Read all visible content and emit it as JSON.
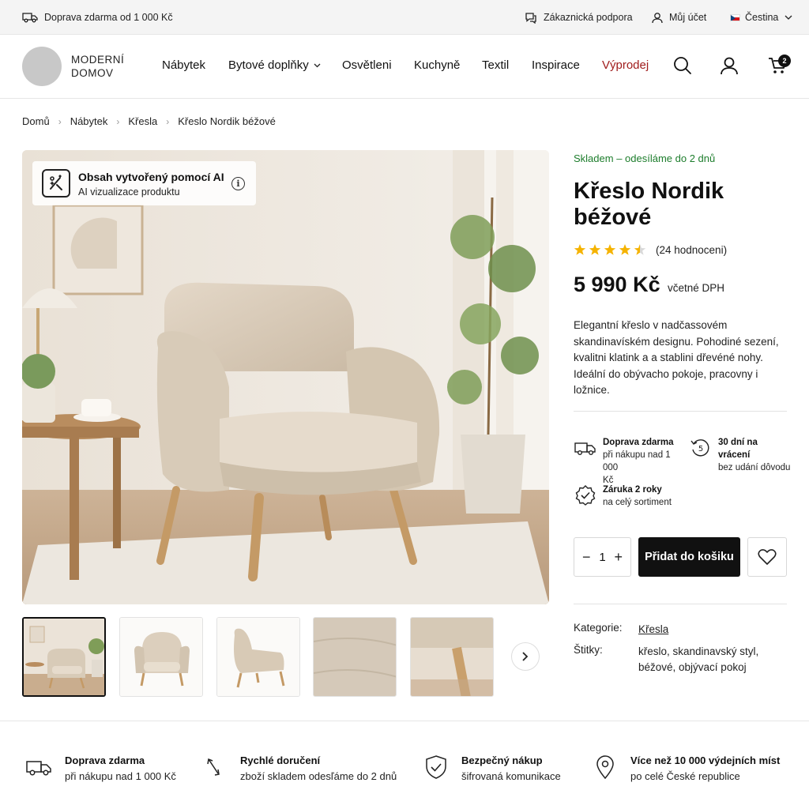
{
  "topbar": {
    "shipping": "Doprava zdarma od 1 000 Kč",
    "support": "Zákaznická podpora",
    "account": "Můj účet",
    "language": "Čestina"
  },
  "header": {
    "logo_line1": "MODERNÍ",
    "logo_line2": "DOMOV",
    "nav": [
      "Nábytek",
      "Bytové doplňky",
      "Osvětleni",
      "Kuchyně",
      "Textil",
      "Inspirace",
      "Výprodej"
    ],
    "cart_count": "2"
  },
  "breadcrumb": [
    "Domů",
    "Nábytek",
    "Křesla",
    "Křeslo Nordik béžové"
  ],
  "ai_badge": {
    "title": "Obsah vytvořený pomocí AI",
    "subtitle": "AI vizualizace produktu"
  },
  "product": {
    "stock": "Skladem – odesíláme do 2 dnů",
    "title_line1": "Křeslo Nordik",
    "title_line2": "béžové",
    "rating_value": 4.5,
    "rating_count": "(24 hodnoceni)",
    "price": "5 990 Kč",
    "price_note": "včetné DPH",
    "description": [
      "Elegantní křeslo v nadčassovém",
      "skandinavíském designu. Pohodiné sezení,",
      "kvalitni klatink a a stablini dřevéné nohy.",
      "Ideální do obývacho pokoje, pracovny i ložnice."
    ],
    "quantity": "1",
    "add_to_cart": "Přidat do košiku",
    "category_label": "Kategorie:",
    "category_value": "Křesla",
    "tags_label": "Štitky:",
    "tags_line1": "křeslo, skandinavský styl,",
    "tags_line2": "béžové, objývací pokoj"
  },
  "benefits": [
    {
      "title": "Doprava zdarma",
      "text": [
        "při nákupu nad 1 000",
        "Kč"
      ]
    },
    {
      "title": "30 dní na vrácení",
      "text": [
        "bez udání dôvodu"
      ]
    },
    {
      "title": "Záruka 2 roky",
      "text": [
        "na celý sortiment"
      ]
    }
  ],
  "footer": [
    {
      "title": "Doprava zdarma",
      "text": "při nákupu nad 1 000 Kč"
    },
    {
      "title": "Rychlé doručení",
      "text": "zboží skladem odesľáme do 2 dnů"
    },
    {
      "title": "Bezpečný nákup",
      "text": "šifrovaná komunikace"
    },
    {
      "title": "Více než 10 000 výdejních míst",
      "text": "po celé České republice"
    }
  ],
  "colors": {
    "accent_sale": "#a01d1d",
    "stock_green": "#1d7d2c",
    "star": "#f5b301",
    "button_dark": "#111111"
  }
}
